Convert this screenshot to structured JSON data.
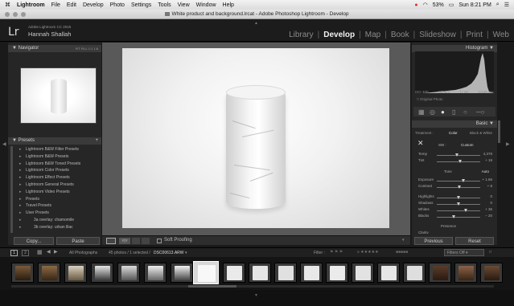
{
  "menubar": {
    "apple": "",
    "app_name": "Lightroom",
    "items": [
      "File",
      "Edit",
      "Develop",
      "Photo",
      "Settings",
      "Tools",
      "View",
      "Window",
      "Help"
    ],
    "battery": "53%",
    "clock": "Sun 8:21 PM"
  },
  "window": {
    "title": "White product and background.lrcat - Adobe Photoshop Lightroom - Develop"
  },
  "identity": {
    "logo": "Lr",
    "product": "Adobe Lightroom CC 2015",
    "user": "Hannah Shallah"
  },
  "modules": [
    "Library",
    "Develop",
    "Map",
    "Book",
    "Slideshow",
    "Print",
    "Web"
  ],
  "active_module": "Develop",
  "left_panel": {
    "navigator_title": "Navigator",
    "navigator_zoom": [
      "FIT",
      "FILL",
      "1:1",
      "1:8"
    ],
    "presets_title": "Presets",
    "presets": [
      "Lightroom B&W Filter Presets",
      "Lightroom B&W Presets",
      "Lightroom B&W Toned Presets",
      "Lightroom Color Presets",
      "Lightroom Effect Presets",
      "Lightroom General Presets",
      "Lightroom Video Presets",
      "Presets",
      "Travel Presets",
      "User Presets",
      "3a overlay: chamomile",
      "3b overlay: urban lilac"
    ],
    "copy_label": "Copy...",
    "paste_label": "Paste"
  },
  "toolbar": {
    "soft_proofing": "Soft Proofing"
  },
  "right_panel": {
    "histogram_title": "Histogram",
    "hist_iso": "ISO 400",
    "hist_focal": "55 mm",
    "hist_aperture": "f / 18",
    "hist_shutter": "1/125 sec",
    "original_photo": "Original Photo",
    "basic_title": "Basic",
    "treatment_label": "Treatment :",
    "color": "Color",
    "bw": "Black & White",
    "wb_label": "WB :",
    "wb_value": "Custom",
    "sliders": [
      {
        "label": "Temp",
        "value": "4,378",
        "pos": 0.48
      },
      {
        "label": "Tint",
        "value": "+ 19",
        "pos": 0.55
      },
      {
        "label": "Exposure",
        "value": "+ 1.66",
        "pos": 0.62
      },
      {
        "label": "Contrast",
        "value": "+ 8",
        "pos": 0.52
      },
      {
        "label": "Highlights",
        "value": "0",
        "pos": 0.5
      },
      {
        "label": "Shadows",
        "value": "0",
        "pos": 0.5
      },
      {
        "label": "Whites",
        "value": "+ 36",
        "pos": 0.68
      },
      {
        "label": "Blacks",
        "value": "− 20",
        "pos": 0.4
      }
    ],
    "tone_label": "Tone",
    "auto_label": "Auto",
    "presence_label": "Presence",
    "clarity_label": "Clarity",
    "previous_label": "Previous",
    "reset_label": "Reset"
  },
  "filmstrip_bar": {
    "view1": "1",
    "view2": "2",
    "source": "All Photographs",
    "count": "45 photos / 1 selected /",
    "filename": "DSC00613.ARW",
    "filter_label": "Filter :",
    "filters_off": "Filters Off"
  },
  "colors": {
    "accent": "#f0f0f0",
    "panel": "#262626",
    "background": "#1a1a1a"
  }
}
